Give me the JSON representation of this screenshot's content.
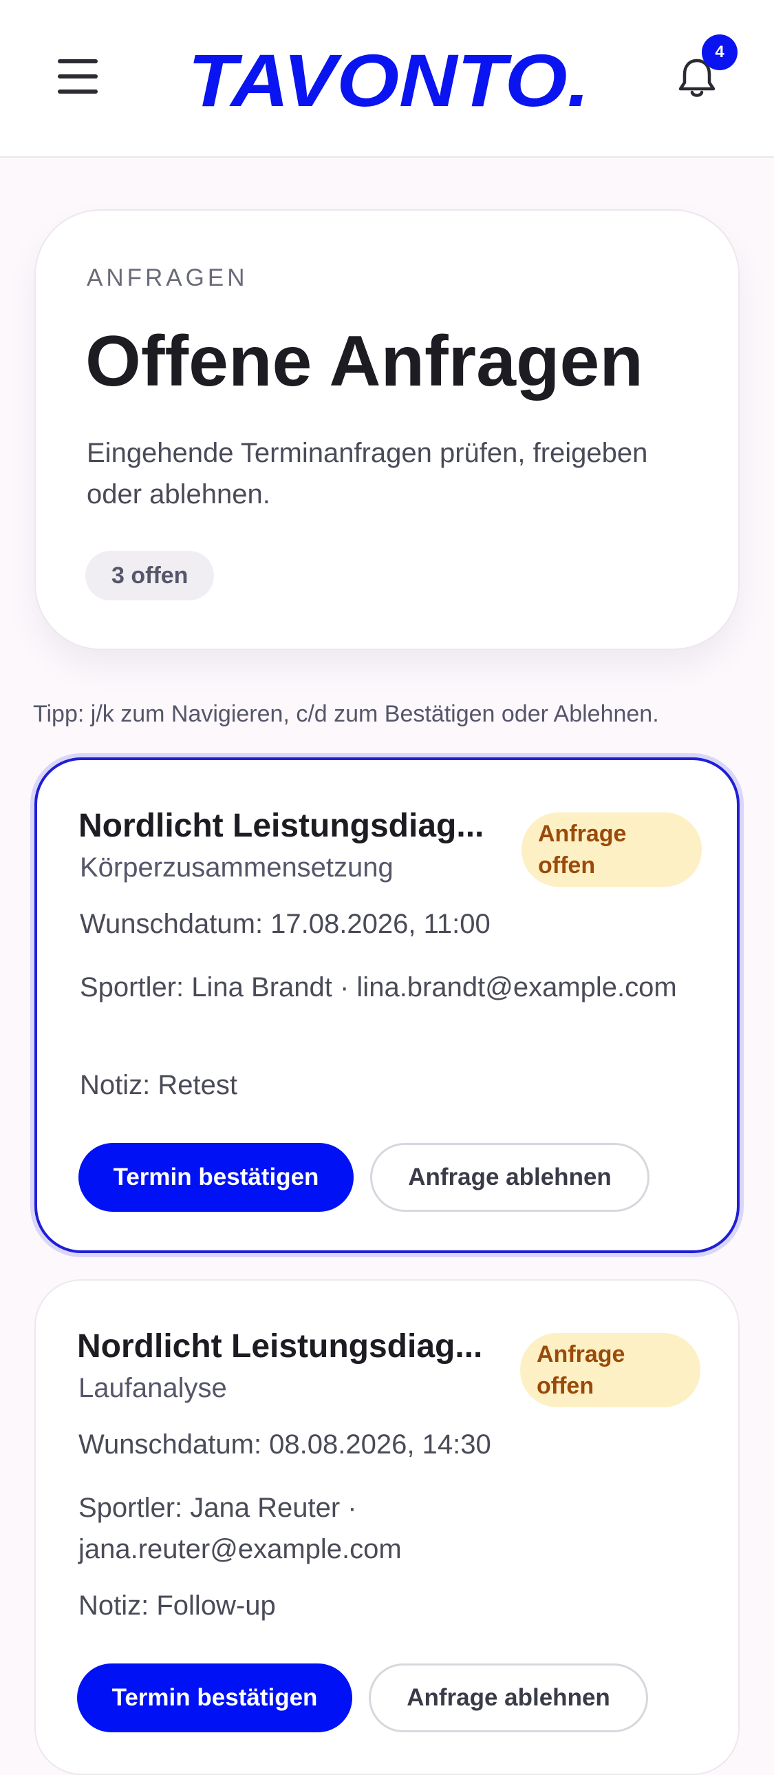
{
  "header": {
    "logo_text": "TAVONTO.",
    "notification_count": "4",
    "brand_color": "#0a14f0"
  },
  "hero": {
    "eyebrow": "ANFRAGEN",
    "title": "Offene Anfragen",
    "description": "Eingehende Terminanfragen prüfen, freigeben oder ablehnen.",
    "open_count": "3 offen"
  },
  "tip": "Tipp: j/k zum Navigieren, c/d zum Bestätigen oder Ablehnen.",
  "requests": [
    {
      "title": "Nordlicht Leistungsdiag...",
      "status": "Anfrage offen",
      "service": "Körperzusammensetzung",
      "date": "Wunschdatum: 17.08.2026, 11:00",
      "athlete": "Sportler: Lina Brandt · lina.brandt@example.com",
      "note": "Notiz: Retest",
      "confirm_label": "Termin bestätigen",
      "decline_label": "Anfrage ablehnen",
      "selected": true
    },
    {
      "title": "Nordlicht Leistungsdiag...",
      "status": "Anfrage offen",
      "service": "Laufanalyse",
      "date": "Wunschdatum: 08.08.2026, 14:30",
      "athlete": "Sportler: Jana Reuter · jana.reuter@example.com",
      "note": "Notiz: Follow-up",
      "confirm_label": "Termin bestätigen",
      "decline_label": "Anfrage ablehnen",
      "selected": false
    }
  ],
  "colors": {
    "accent": "#0012f5",
    "status_bg": "#fdf0c4",
    "status_text": "#9a4a0a"
  }
}
